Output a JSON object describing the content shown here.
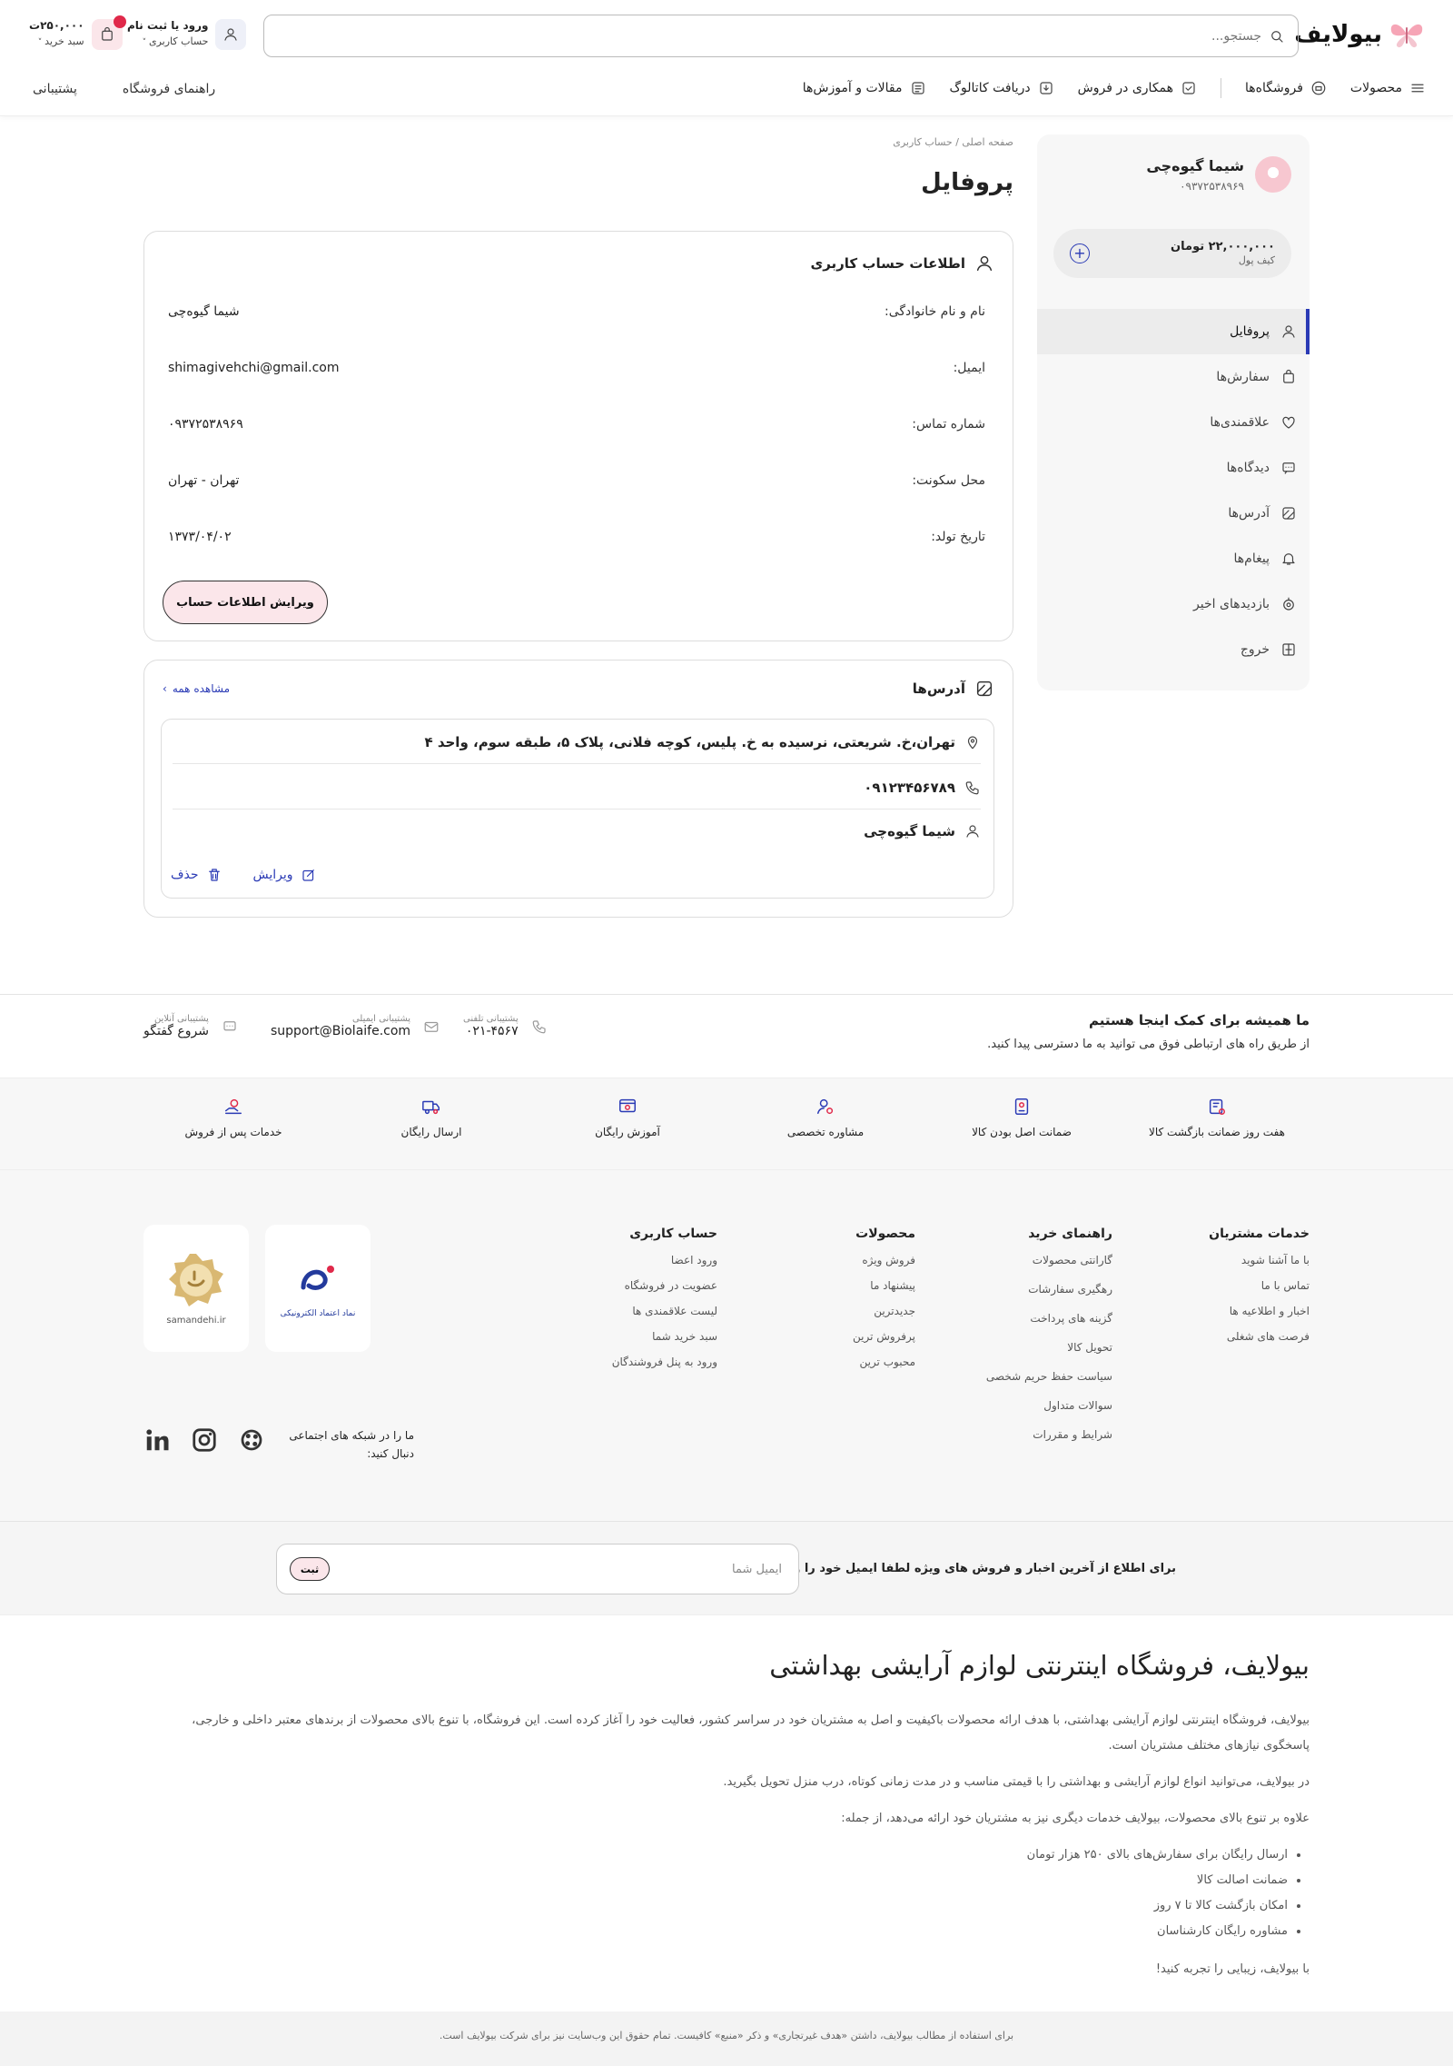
{
  "header": {
    "logo_text": "بیولایف",
    "search_placeholder": "جستجو...",
    "account_title": "ورود یا ثبت نام",
    "account_sub": "حساب کاربری",
    "cart_amount": "۲۵۰,۰۰۰ت",
    "cart_label": "سبد خرید"
  },
  "nav": {
    "items": [
      "محصولات",
      "فروشگاه‌ها",
      "همکاری در فروش",
      "دریافت کاتالوگ",
      "مقالات و آموزش‌ها"
    ],
    "left": [
      "راهنمای فروشگاه",
      "پشتیبانی"
    ]
  },
  "sidebar": {
    "name": "شیما گیوه‌چی",
    "phone": "۰۹۳۷۲۵۳۸۹۶۹",
    "wallet_amount": "۲۲,۰۰۰,۰۰۰ تومان",
    "wallet_label": "کیف پول",
    "items": [
      "پروفایل",
      "سفارش‌ها",
      "علاقمندی‌ها",
      "دیدگاه‌ها",
      "آدرس‌ها",
      "پیغام‌ها",
      "بازدیدهای اخیر",
      "خروج"
    ]
  },
  "breadcrumb": "صفحه اصلی / حساب کاربری",
  "page_title": "پروفایل",
  "account_card": {
    "title": "اطلاعات حساب کاربری",
    "rows": [
      {
        "label": "نام و نام خانوادگی:",
        "value": "شیما گیوه‌چی"
      },
      {
        "label": "ایمیل:",
        "value": "shimagivehchi@gmail.com"
      },
      {
        "label": "شماره تماس:",
        "value": "۰۹۳۷۲۵۳۸۹۶۹"
      },
      {
        "label": "محل سکونت:",
        "value": "تهران - تهران"
      },
      {
        "label": "تاریخ تولد:",
        "value": "۱۳۷۳/۰۴/۰۲"
      }
    ],
    "edit_button": "ویرایش اطلاعات حساب"
  },
  "address_card": {
    "title": "آدرس‌ها",
    "see_all": "مشاهده همه",
    "address": "تهران،خ. شریعتی، نرسیده به خ. پلیس، کوچه فلانی، پلاک ۵، طبقه سوم، واحد ۴",
    "phone": "۰۹۱۲۳۴۵۶۷۸۹",
    "name": "شیما گیوه‌چی",
    "edit": "ویرایش",
    "delete": "حذف"
  },
  "contact": {
    "title": "ما همیشه برای کمک اینجا هستیم",
    "subtitle": "از طریق راه های ارتباطی فوق می توانید به ما دسترسی پیدا کنید.",
    "phone_label": "پشتیبانی تلفنی",
    "phone": "۰۲۱-۴۵۶۷",
    "email_label": "پشتیبانی ایمیلی",
    "email": "support@Biolaife.com",
    "chat_label": "پشتیبانی آنلاین",
    "chat": "شروع گفتگو"
  },
  "features": [
    "هفت روز ضمانت بازگشت کالا",
    "ضمانت اصل بودن کالا",
    "مشاوره تخصصی",
    "آموزش رایگان",
    "ارسال رایگان",
    "خدمات پس از فروش"
  ],
  "footer_cols": [
    {
      "title": "خدمات مشتریان",
      "links": [
        "با ما آشنا شوید",
        "تماس با ما",
        "اخبار و اطلاعیه ها",
        "فرصت های شغلی"
      ]
    },
    {
      "title": "راهنمای خرید",
      "links": [
        "گارانتی محصولات",
        "رهگیری سفارشات",
        "گزینه های پرداخت",
        "تحویل کالا",
        "سیاست حفظ حریم شخصی",
        "سوالات متداول",
        "شرایط و مقررات"
      ]
    },
    {
      "title": "محصولات",
      "links": [
        "فروش ویژه",
        "پیشنهاد ما",
        "جدیدترین",
        "پرفروش ترین",
        "محبوب ترین"
      ]
    },
    {
      "title": "حساب کاربری",
      "links": [
        "ورود اعضا",
        "عضویت در فروشگاه",
        "لیست علاقمندی ها",
        "سبد خرید شما",
        "ورود به پنل فروشندگان"
      ]
    }
  ],
  "trust": {
    "enamad": "نماد اعتماد الکترونیکی",
    "samandehi": "samandehi.ir"
  },
  "social_text": "ما را در شبکه های اجتماعی دنبال کنید:",
  "newsletter": {
    "label": "برای اطلاع از آخرین اخبار و فروش های ویژه لطفا ایمیل خود را وارد کنید :",
    "placeholder": "ایمیل شما",
    "button": "ثبت"
  },
  "about": {
    "title": "بیولایف، فروشگاه اینترنتی لوازم آرایشی بهداشتی",
    "p1": "بیولایف، فروشگاه اینترنتی لوازم آرایشی بهداشتی، با هدف ارائه محصولات باکیفیت و اصل به مشتریان خود در سراسر کشور، فعالیت خود را آغاز کرده است. این فروشگاه، با تنوع بالای محصولات از برندهای معتبر داخلی و خارجی، پاسخگوی نیازهای مختلف مشتریان است.",
    "p2": "در بیولایف، می‌توانید انواع لوازم آرایشی و بهداشتی را با قیمتی مناسب و در مدت زمانی کوتاه، درب منزل تحویل بگیرید.",
    "p3": "علاوه بر تنوع بالای محصولات، بیولایف خدمات دیگری نیز به مشتریان خود ارائه می‌دهد، از جمله:",
    "list": [
      "ارسال رایگان برای سفارش‌های بالای ۲۵۰ هزار تومان",
      "ضمانت اصالت کالا",
      "امکان بازگشت کالا تا ۷ روز",
      "مشاوره رایگان کارشناسان"
    ],
    "p4": "با بیولایف، زیبایی را تجربه کنید!"
  },
  "copyright": "برای استفاده از مطالب بیولایف، داشتن «هدف غیرتجاری» و ذکر «منبع» کافیست. تمام حقوق این وب‌سایت نیز برای شرکت بیولایف است."
}
